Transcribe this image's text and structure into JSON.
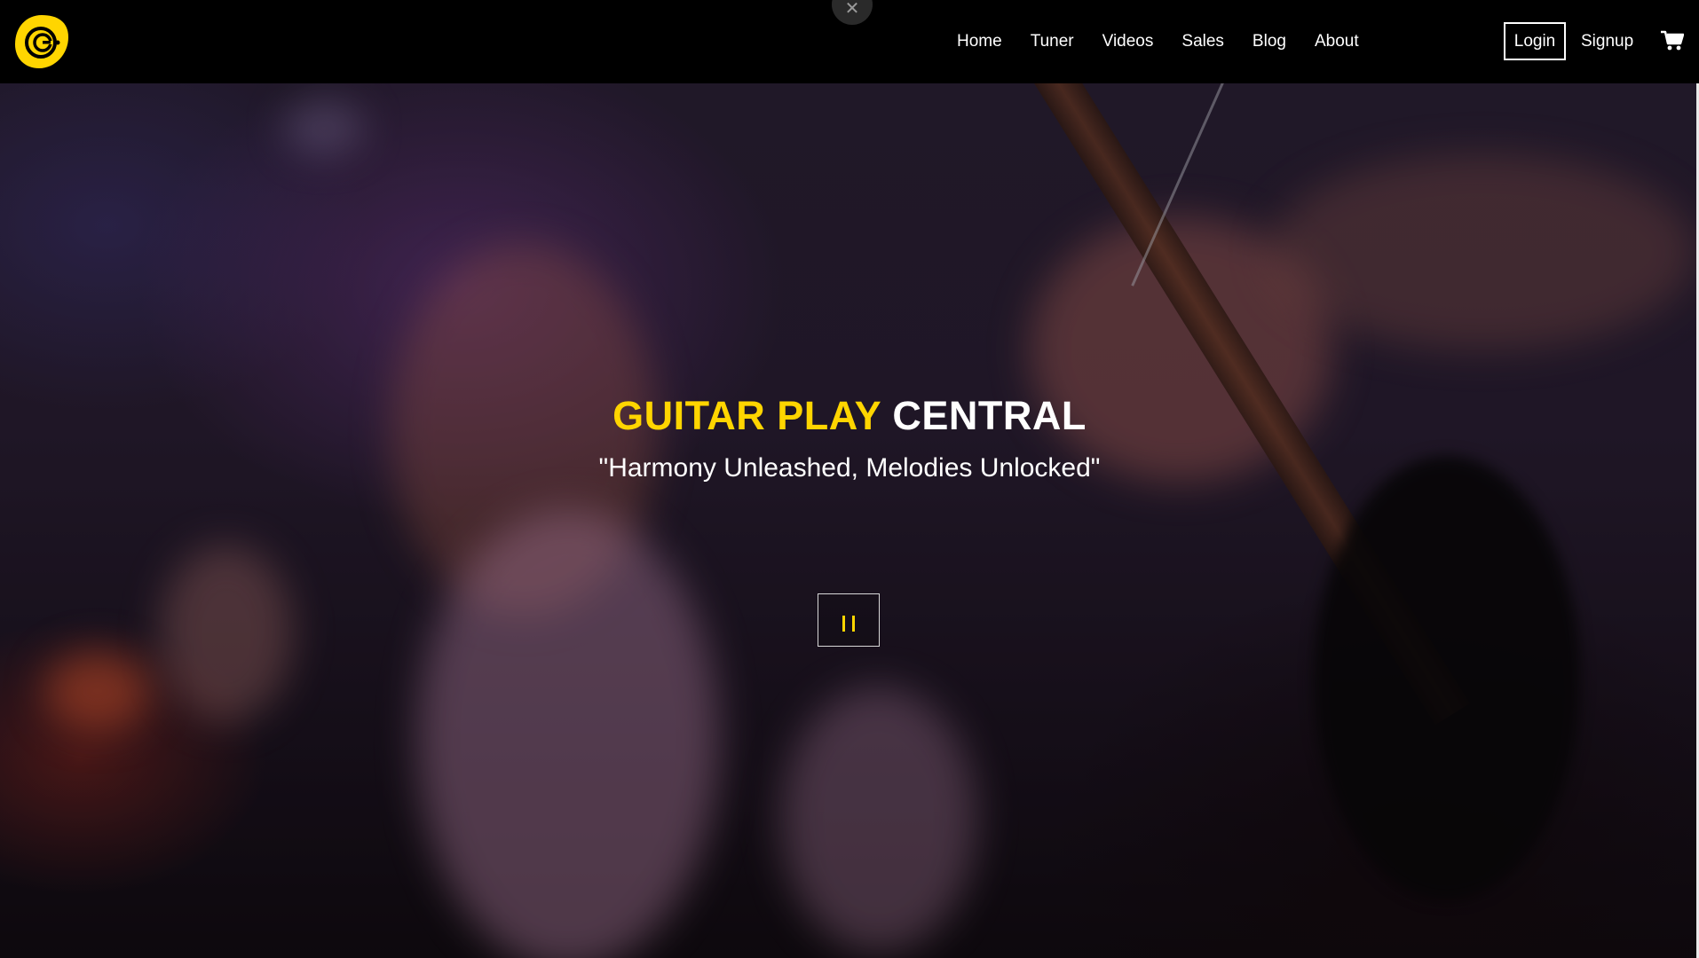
{
  "header": {
    "logo_icon": "guitar-central-logo-icon",
    "close_icon": "close-icon",
    "nav": [
      {
        "label": "Home"
      },
      {
        "label": "Tuner"
      },
      {
        "label": "Videos"
      },
      {
        "label": "Sales"
      },
      {
        "label": "Blog"
      },
      {
        "label": "About"
      }
    ],
    "login_label": "Login",
    "signup_label": "Signup",
    "cart_icon": "cart-icon"
  },
  "hero": {
    "title_accent": "GUITAR PLAY",
    "title_main": "CENTRAL",
    "tagline": "\"Harmony Unleashed, Melodies Unlocked\"",
    "pause_icon": "pause-icon"
  },
  "colors": {
    "accent": "#ffd500",
    "navbar": "#000000",
    "text": "#ffffff"
  }
}
